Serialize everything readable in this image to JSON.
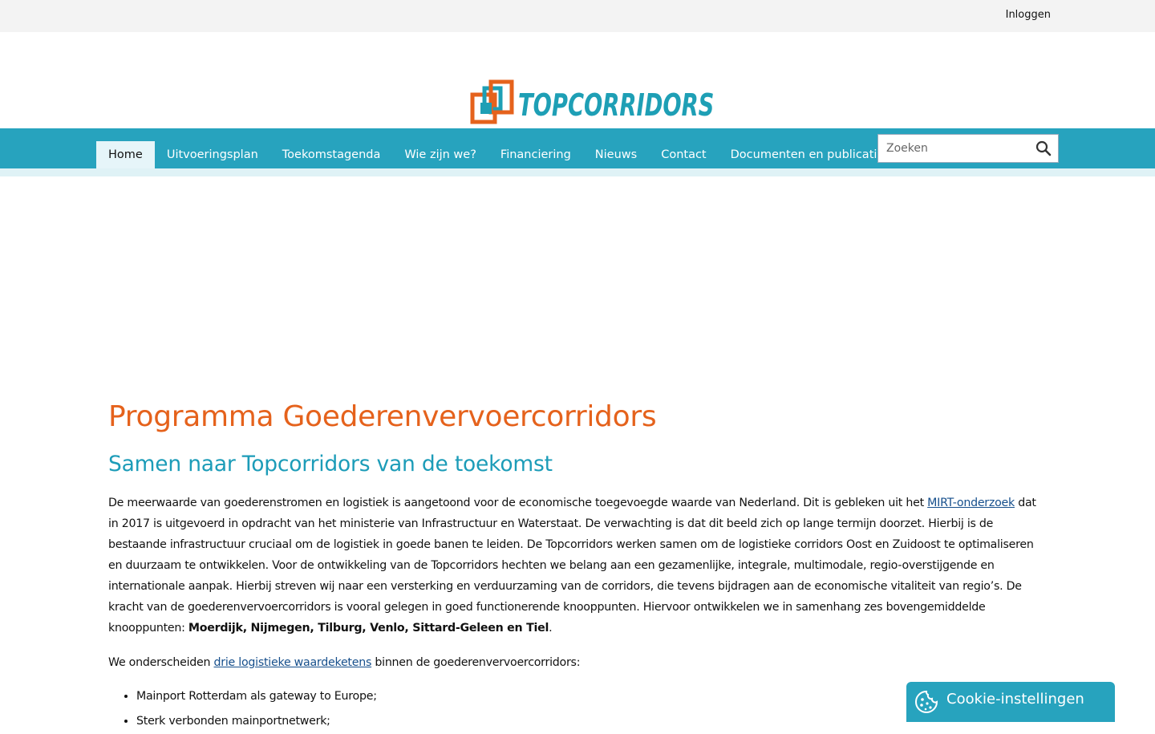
{
  "topbar": {
    "login_label": "Inloggen"
  },
  "logo": {
    "text": "TOPCORRIDORS",
    "colors": {
      "orange": "#e5621c",
      "teal": "#1e9fb5"
    }
  },
  "nav": {
    "items": [
      {
        "label": "Home",
        "active": true
      },
      {
        "label": "Uitvoeringsplan"
      },
      {
        "label": "Toekomstagenda"
      },
      {
        "label": "Wie zijn we?"
      },
      {
        "label": "Financiering"
      },
      {
        "label": "Nieuws"
      },
      {
        "label": "Contact"
      },
      {
        "label": "Documenten en publicaties"
      }
    ],
    "search": {
      "placeholder": "Zoeken",
      "icon": "search-icon"
    }
  },
  "main": {
    "title": "Programma Goederenvervoercorridors",
    "subtitle": "Samen naar Topcorridors van de toekomst",
    "para1": {
      "before_link": "De meerwaarde van goederenstromen en logistiek is aangetoond voor de economische toegevoegde waarde van Nederland. Dit is gebleken uit het ",
      "link": "MIRT-onderzoek",
      "after_link": " dat in 2017 is uitgevoerd in opdracht van het ministerie van Infrastructuur en Waterstaat. De verwachting is dat dit beeld zich op lange termijn doorzet. Hierbij is de bestaande infrastructuur cruciaal om de logistiek in goede banen te leiden. De Topcorridors werken samen om de logistieke corridors Oost en Zuidoost te optimaliseren en duurzaam te ontwikkelen. Voor de ontwikkeling van de Topcorridors hechten we belang aan een gezamenlijke, integrale, multimodale, regio-overstijgende en internationale aanpak. Hierbij streven wij naar een versterking en verduurzaming van de corridors, die tevens bijdragen aan de economische vitaliteit van regio’s. De kracht van de goederenvervoercorridors is vooral gelegen in goed functionerende knooppunten. Hiervoor ontwikkelen we in samenhang zes bovengemiddelde knooppunten: ",
      "bold": "Moerdijk, Nijmegen, Tilburg, Venlo, Sittard-Geleen en Tiel",
      "end": "."
    },
    "para2": {
      "before_link": "We onderscheiden ",
      "link": "drie logistieke waardeketens",
      "after_link": " binnen de goederenvervoercorridors:"
    },
    "list": [
      "Mainport Rotterdam als gateway to Europe;",
      "Sterk verbonden mainportnetwerk;"
    ]
  },
  "cookie": {
    "label": "Cookie-instellingen",
    "icon": "cookie-icon"
  },
  "colors": {
    "nav_bg": "#27a3be",
    "title": "#e5621c",
    "subtitle": "#1c9cb8",
    "link": "#164f8c"
  }
}
